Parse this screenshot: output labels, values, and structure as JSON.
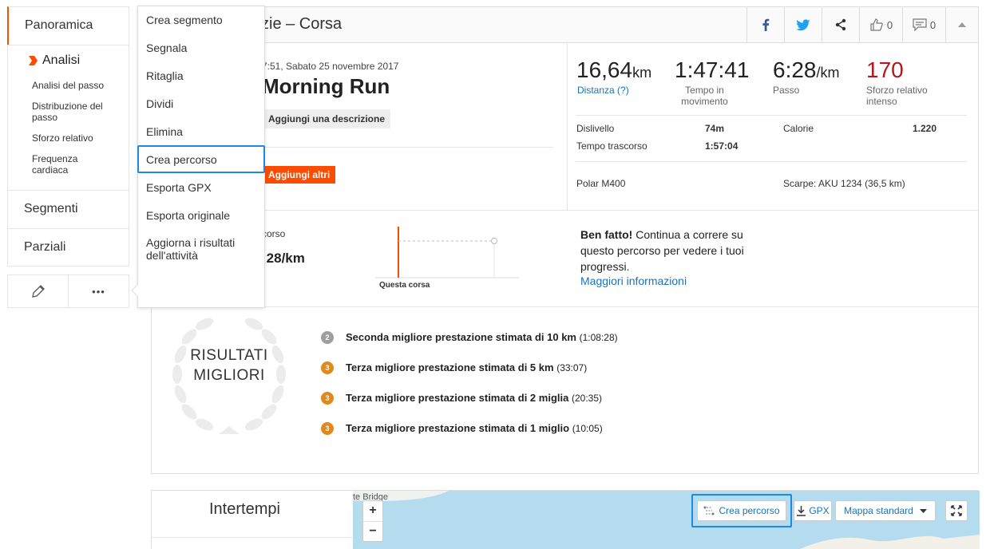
{
  "sidebar": {
    "tabs": {
      "panoramica": "Panoramica",
      "analisi": "Analisi",
      "segmenti": "Segmenti",
      "parziali": "Parziali"
    },
    "analisi_items": [
      "Analisi del passo",
      "Distribuzione del passo",
      "Sforzo relativo",
      "Frequenza cardiaca"
    ],
    "more_label": "•••"
  },
  "menu": {
    "items": [
      "Crea segmento",
      "Segnala",
      "Ritaglia",
      "Dividi",
      "Elimina",
      "Crea percorso",
      "Esporta GPX",
      "Esporta originale",
      "Aggiorna i risultati dell'attività"
    ],
    "highlighted_index": 5
  },
  "header": {
    "title": "zie – Corsa",
    "kudos_count": "0",
    "comments_count": "0"
  },
  "activity": {
    "datetime": "7:51, Sabato 25 novembre 2017",
    "name": "Morning Run",
    "add_description": "Aggiungi una descrizione",
    "add_others": "Aggiungi altri"
  },
  "stats": {
    "distance": "16,64",
    "distance_unit": "km",
    "distance_label": "Distanza (?)",
    "moving_time": "1:47:41",
    "moving_time_label": "Tempo in movimento",
    "pace": "6:28",
    "pace_unit": "/km",
    "pace_label": "Passo",
    "effort": "170",
    "effort_label": "Sforzo relativo intenso",
    "elevation_label": "Dislivello",
    "elevation_value": "74m",
    "calories_label": "Calorie",
    "calories_value": "1.220",
    "elapsed_label": "Tempo trascorso",
    "elapsed_value": "1:57:04",
    "device": "Polar M400",
    "shoes": "Scarpe: AKU 1234 (36,5 km)"
  },
  "pace_compare": {
    "label": "corso",
    "value": ":28/km",
    "this_run": "Questa corsa",
    "well_done_bold": "Ben fatto!",
    "well_done_text": "Continua a correre su questo percorso per vedere i tuoi progressi.",
    "more_info": "Maggiori informazioni"
  },
  "best_efforts": {
    "badge": "RISULTATI MIGLIORI",
    "items": [
      {
        "rank": "2",
        "title": "Seconda migliore prestazione stimata di 10 km",
        "time": "(1:08:28)"
      },
      {
        "rank": "3",
        "title": "Terza migliore prestazione stimata di 5 km",
        "time": "(33:07)"
      },
      {
        "rank": "3",
        "title": "Terza migliore prestazione stimata di 2 miglia",
        "time": "(20:35)"
      },
      {
        "rank": "3",
        "title": "Terza migliore prestazione stimata di 1 miglio",
        "time": "(10:05)"
      }
    ]
  },
  "bottom": {
    "intertempi": "Intertempi",
    "map_label": "te Bridge",
    "zoom_in": "+",
    "zoom_out": "−",
    "crea_percorso": "Crea percorso",
    "gpx": "GPX",
    "map_style": "Mappa standard"
  },
  "colors": {
    "accent": "#fc4c02",
    "link": "#1a73b8",
    "highlight": "#1e88e5",
    "effort": "#b0171f",
    "silver": "#9e9e9e",
    "bronze": "#e08a1e"
  }
}
